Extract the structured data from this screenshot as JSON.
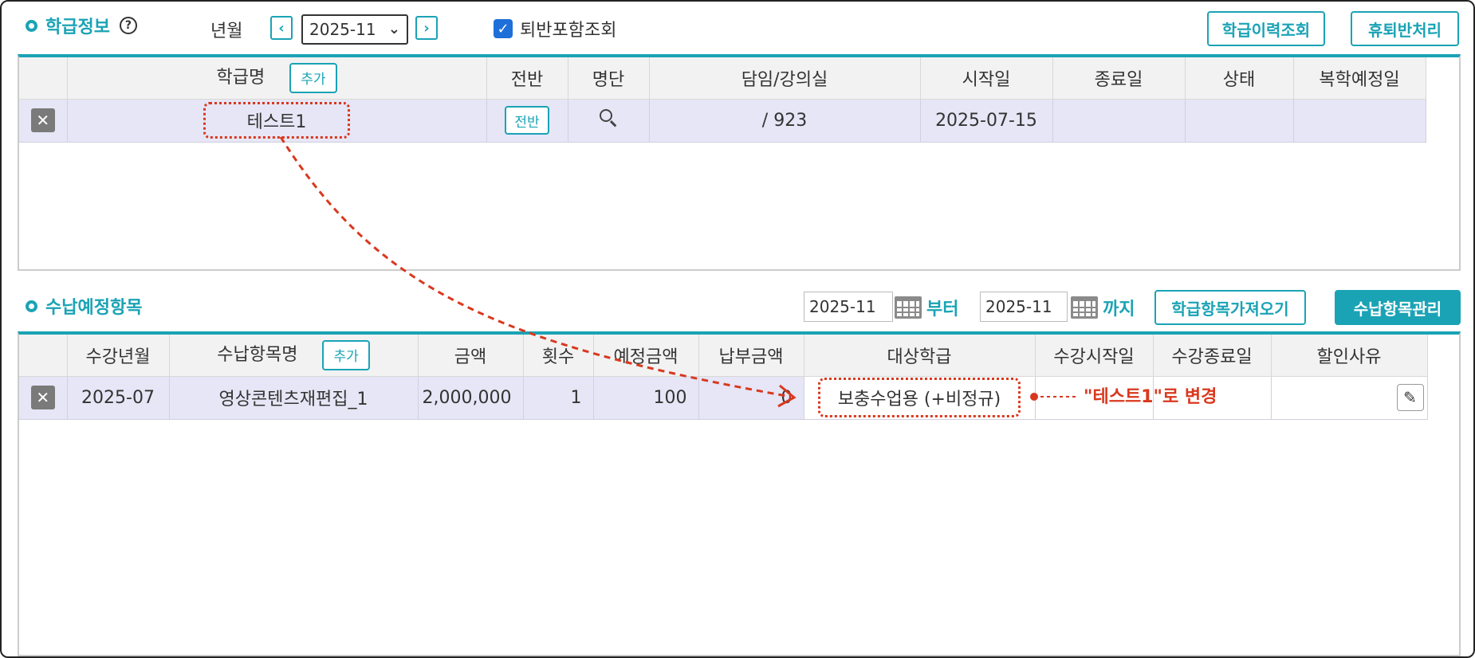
{
  "class_section": {
    "title": "학급정보",
    "help_icon": "question-circle-icon",
    "year_month_label": "년월",
    "year_month_value": "2025-11",
    "include_withdrawn_label": "퇴반포함조회",
    "include_withdrawn_checked": true,
    "history_button": "학급이력조회",
    "leave_button": "휴퇴반처리",
    "columns": {
      "name": "학급명",
      "add": "추가",
      "transfer": "전반",
      "roster": "명단",
      "teacher_room": "담임/강의실",
      "start": "시작일",
      "end": "종료일",
      "status": "상태",
      "return_date": "복학예정일"
    },
    "rows": [
      {
        "name": "테스트1",
        "transfer_button": "전반",
        "teacher_room": "/ 923",
        "start": "2025-07-15",
        "end": "",
        "status": "",
        "return_date": ""
      }
    ]
  },
  "payment_section": {
    "title": "수납예정항목",
    "from_value": "2025-11",
    "from_label": "부터",
    "to_value": "2025-11",
    "to_label": "까지",
    "import_button": "학급항목가져오기",
    "manage_button": "수납항목관리",
    "columns": {
      "ym": "수강년월",
      "item_name": "수납항목명",
      "add": "추가",
      "amount": "금액",
      "count": "횟수",
      "expected": "예정금액",
      "paid": "납부금액",
      "target_class": "대상학급",
      "start": "수강시작일",
      "end": "수강종료일",
      "discount": "할인사유"
    },
    "rows": [
      {
        "ym": "2025-07",
        "item_name": "영상콘텐츠재편집_1",
        "amount": "2,000,000",
        "count": "1",
        "expected": "100",
        "paid": "0",
        "target_class": "보충수업용 (+비정규)",
        "start": "",
        "end": "",
        "discount": ""
      }
    ]
  },
  "annotation": {
    "text": "\"테스트1\"로 변경",
    "color": "#d9381e"
  },
  "colors": {
    "accent": "#1aa3b5",
    "row_highlight": "#e6e6f6",
    "header_bg": "#f2f2f2",
    "annotation": "#d9381e"
  }
}
